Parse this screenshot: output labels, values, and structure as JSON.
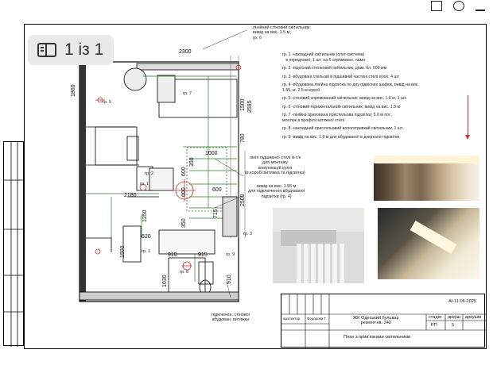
{
  "viewer": {
    "page_counter": "1 із 1"
  },
  "plan": {
    "top_note": "лінійний стіновий світильник;\nвивід на вис. 1.5 м;\nгр. 6",
    "dims": {
      "d2300": "2300",
      "d1860": "1860",
      "d1500": "1500",
      "d2595": "2595",
      "d780": "780",
      "d1000": "1000",
      "d600a": "600",
      "d600b": "600",
      "d600c": "600",
      "d350a": "350",
      "d350b": "350",
      "d2180": "2180",
      "d2500": "2500",
      "d715": "715",
      "d1250": "1250",
      "d620": "620",
      "d1500b": "1500",
      "d910a": "910",
      "d915": "915",
      "d1030": "1030",
      "d910b": "910"
    },
    "group_labels": {
      "g7": "гр. 7",
      "g5": "гр. 5",
      "g2": "гр. 2",
      "g1a": "гр. 1",
      "g1b": "гр. 1",
      "g3": "гр. 3",
      "g9": "гр. 9",
      "g8": "гр. 8"
    },
    "callouts": {
      "ceiling_line": "лінія підшивної стелі із г/к\nдля монтажу\nкомунікацій кухні\n(в коробі витяжка та підсвітка)",
      "outlet": "вивід на вис. 1.55 м\nдля підключення вбудованої\nпідсвітки (гр. 4)",
      "bottom": "підключен. стіновоі\nвбудован. витяжки"
    }
  },
  "legend": {
    "items": [
      "гр. 1 -накладний світильник (спот-система)\n   в передпокої, 1 шт. на 6 спрямован. ламп",
      "гр. 2 -підсісний стельовий світильник, діам. бл. 600 мм",
      "гр. 3 -вбудовані стельові в підшивній частині стелі кухні; 4 шт.",
      "гр. 4 -вбудована лінійна підсвітка по дну підвісних шафок, вивід на вис.\n1.55, м. 2.5 м короб",
      "гр. 5 -стіновий спрямований світильник; вивід на вис. 1.6 м; 1 шт.",
      "гр. 6 -стіновий горизонтальний світильник; вивід на вис. 1.5 м",
      "гр. 7 -лінійна прихована пристельова підсвітка; 5.0 м пог.;\nмонтаж в профілі натяжної стелі",
      "гр. 8 -накладний пристельовий вологотривкий світильник, 1 шт.",
      "гр. 9 -вивід на вис. 1.8 м для вбудованої в дзеркало підсвітки"
    ]
  },
  "stamp": {
    "code": "АІ-11.06-2025",
    "project": "ЖК Одеський бульвар\nремонт кв. 242",
    "stage_header": "стадія",
    "sheet_header": "аркуш",
    "sheets_header": "аркушів",
    "stage": "РП",
    "sheet": "5",
    "sheets": "",
    "sheet_title": "План з прив'язками світильників",
    "role": "архітектор",
    "name": "Федорова Т."
  }
}
